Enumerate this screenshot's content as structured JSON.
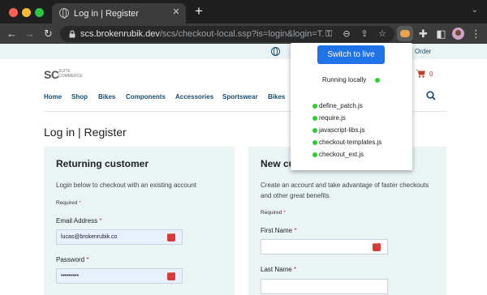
{
  "browser": {
    "tab_title": "Log in | Register",
    "new_tab": "+",
    "url_host": "scs.brokenrubik.dev",
    "url_path": "/scs/checkout-local.ssp?is=login&login=T..."
  },
  "site": {
    "strip_link": "Order",
    "logo_main": "SC",
    "logo_small_1": "SUITE",
    "logo_small_2": "COMMERCE",
    "cart_count": "0",
    "nav": [
      "Home",
      "Shop",
      "Bikes",
      "Components",
      "Accessories",
      "Sportswear",
      "Bikes"
    ],
    "page_title": "Log in | Register"
  },
  "returning": {
    "title": "Returning customer",
    "description": "Login below to checkout with an existing account",
    "required": "Required",
    "email_label": "Email Address",
    "email_value": "lucas@brokenrubik.co",
    "password_label": "Password",
    "password_value": "•••••••••"
  },
  "new_customer": {
    "title": "New cu",
    "description_1": "Create an account and take advantage of faster checkouts",
    "description_2": "and other great benefits.",
    "required": "Required",
    "first_name_label": "First Name",
    "last_name_label": "Last Name"
  },
  "extension": {
    "button": "Switch to live",
    "status": "Running locally",
    "files": [
      "define_patch.js",
      "require.js",
      "javascript-libs.js",
      "checkout-templates.js",
      "checkout_ext.js"
    ],
    "status_color": "#29d032"
  },
  "required_marker": "*"
}
